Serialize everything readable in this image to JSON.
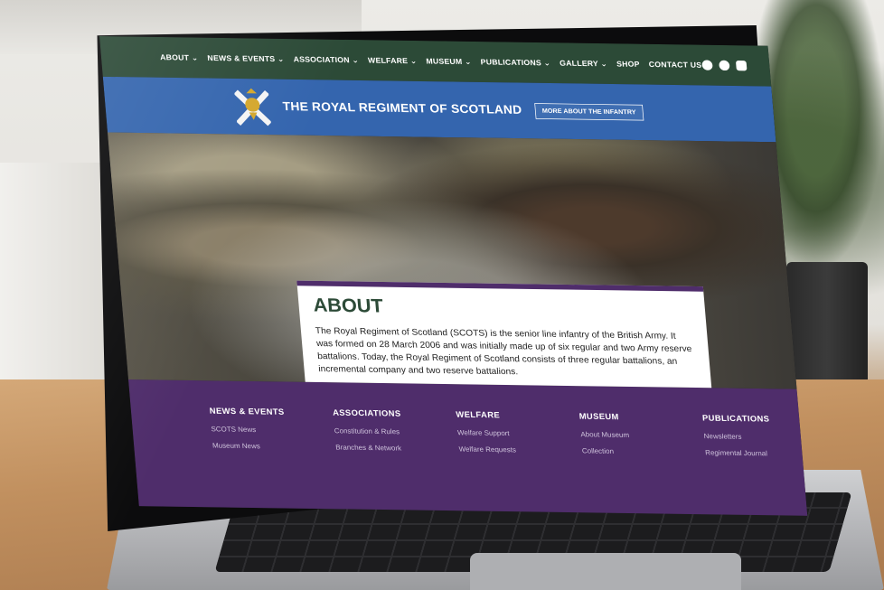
{
  "nav": {
    "items": [
      {
        "label": "ABOUT ⌄"
      },
      {
        "label": "NEWS & EVENTS ⌄"
      },
      {
        "label": "ASSOCIATION ⌄"
      },
      {
        "label": "WELFARE ⌄"
      },
      {
        "label": "MUSEUM ⌄"
      },
      {
        "label": "PUBLICATIONS ⌄"
      },
      {
        "label": "GALLERY ⌄"
      },
      {
        "label": "SHOP"
      },
      {
        "label": "CONTACT US"
      }
    ],
    "social": [
      "facebook-icon",
      "twitter-icon",
      "instagram-icon"
    ]
  },
  "banner": {
    "title": "THE ROYAL REGIMENT OF SCOTLAND",
    "cta": "MORE ABOUT THE INFANTRY"
  },
  "about": {
    "heading": "ABOUT",
    "text": "The Royal Regiment of Scotland (SCOTS) is the senior line infantry of the British Army. It was formed on 28 March 2006 and was initially made up of six regular and two Army reserve battalions. Today, the Royal Regiment of Scotland consists of three regular battalions, an incremental company and two reserve battalions."
  },
  "footer": {
    "columns": [
      {
        "heading": "NEWS & EVENTS",
        "links": [
          "SCOTS News",
          "Museum News"
        ]
      },
      {
        "heading": "ASSOCIATIONS",
        "links": [
          "Constitution & Rules",
          "Branches & Network"
        ]
      },
      {
        "heading": "WELFARE",
        "links": [
          "Welfare Support",
          "Welfare Requests"
        ]
      },
      {
        "heading": "MUSEUM",
        "links": [
          "About Museum",
          "Collection"
        ]
      },
      {
        "heading": "PUBLICATIONS",
        "links": [
          "Newsletters",
          "Regimental Journal"
        ]
      }
    ]
  },
  "colors": {
    "nav_bg": "#2c4a37",
    "banner_bg": "#3465ae",
    "accent_purple": "#4f2d6b"
  }
}
